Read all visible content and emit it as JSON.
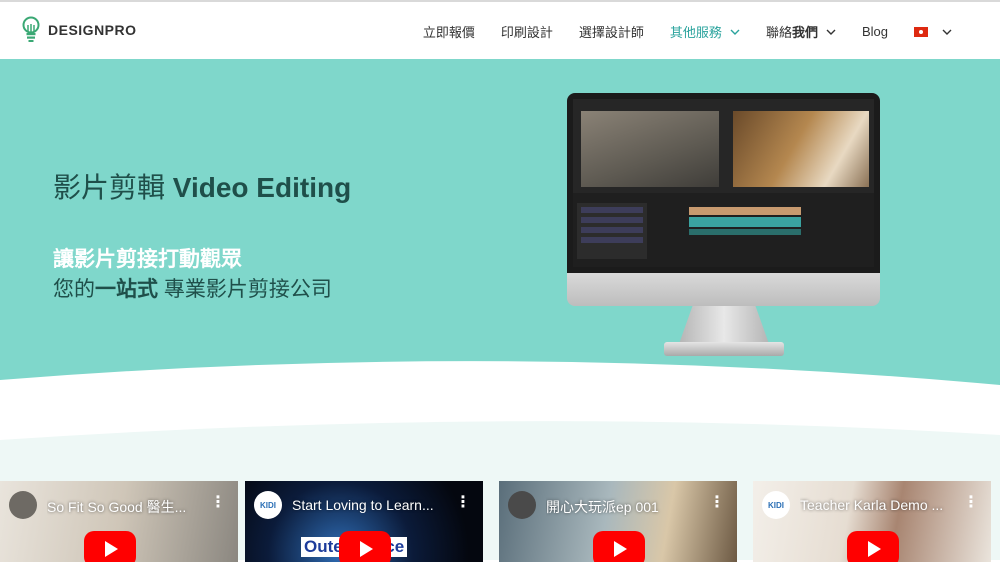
{
  "brand": {
    "name": "DESIGNPRO"
  },
  "nav": {
    "items": [
      {
        "label": "立即報價",
        "active": false,
        "dropdown": false
      },
      {
        "label": "印刷設計",
        "active": false,
        "dropdown": false
      },
      {
        "label": "選擇設計師",
        "active": false,
        "dropdown": false
      },
      {
        "label": "其他服務",
        "active": true,
        "dropdown": true
      },
      {
        "label_pre": "聯絡",
        "label_bold": "我們",
        "active": false,
        "dropdown": true
      },
      {
        "label": "Blog",
        "active": false,
        "dropdown": false
      }
    ],
    "language_flag": "hong-kong-flag-icon"
  },
  "hero": {
    "title_zh": "影片剪輯",
    "title_en": "Video Editing",
    "subtitle_line1": "讓影片剪接打動觀眾",
    "subtitle_line2_pre": "您的",
    "subtitle_line2_bold": "一站式",
    "subtitle_line2_post": " 專業影片剪接公司"
  },
  "colors": {
    "hero_bg": "#7fd7cb",
    "accent": "#2aa39d",
    "youtube_red": "#ff0000"
  },
  "videos": [
    {
      "title": "So Fit So Good 醫生...",
      "menu": "⋮"
    },
    {
      "title": "Start Loving to Learn...",
      "menu": "⋮",
      "overlay_text": "Outer Space",
      "avatar_text": "KIDI"
    },
    {
      "title": "開心大玩派ep 001",
      "menu": "⋮"
    },
    {
      "title": "Teacher Karla Demo ...",
      "menu": "⋮",
      "avatar_text": "KIDI"
    }
  ]
}
